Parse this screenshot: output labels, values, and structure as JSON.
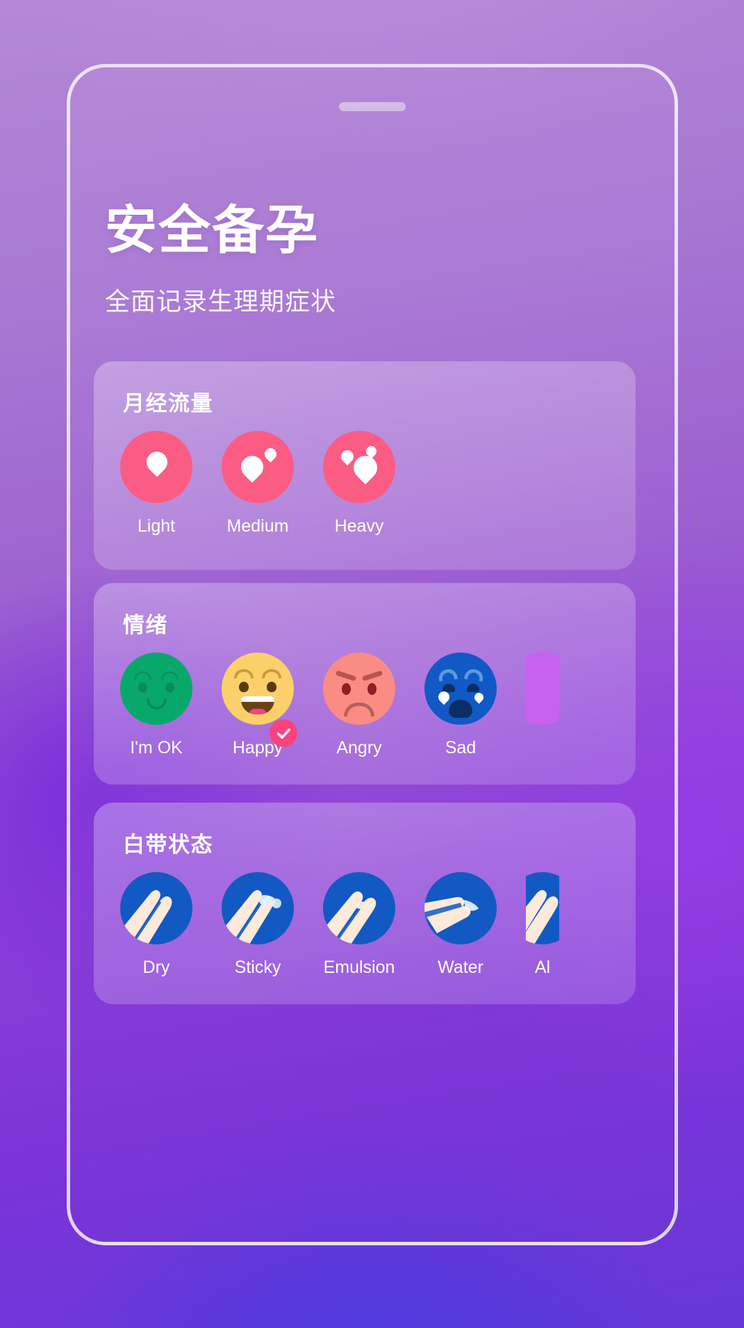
{
  "header": {
    "title": "安全备孕",
    "subtitle": "全面记录生理期症状"
  },
  "theme": {
    "background_top": "#b488d6",
    "background_bottom": "#6638d6",
    "flow_accent": "#fb5c84",
    "discharge_accent": "#1259c4",
    "selected_badge": "#f8437f",
    "card_surface": "rgba(255,255,255,0.25)"
  },
  "cards": {
    "flow": {
      "title": "月经流量",
      "options": [
        {
          "label": "Light",
          "drops": 1,
          "selected": false
        },
        {
          "label": "Medium",
          "drops": 2,
          "selected": false
        },
        {
          "label": "Heavy",
          "drops": 3,
          "selected": false
        }
      ]
    },
    "mood": {
      "title": "情绪",
      "options": [
        {
          "label": "I'm OK",
          "face": "neutral-smile",
          "color": "#08a86b",
          "selected": false
        },
        {
          "label": "Happy",
          "face": "grin",
          "color": "#fbd06a",
          "selected": true
        },
        {
          "label": "Angry",
          "face": "frown-brows",
          "color": "#fb8c84",
          "selected": false
        },
        {
          "label": "Sad",
          "face": "crying",
          "color": "#1159c4",
          "selected": false
        },
        {
          "label": "",
          "face": "partial",
          "color": "#c762ef",
          "selected": false
        }
      ]
    },
    "discharge": {
      "title": "白带状态",
      "options": [
        {
          "label": "Dry",
          "variant": "dry",
          "selected": false
        },
        {
          "label": "Sticky",
          "variant": "sticky",
          "selected": false
        },
        {
          "label": "Emulsion",
          "variant": "emulsion",
          "selected": false
        },
        {
          "label": "Water",
          "variant": "water",
          "selected": false
        },
        {
          "label": "Al",
          "variant": "albumen",
          "selected": false
        }
      ]
    }
  }
}
